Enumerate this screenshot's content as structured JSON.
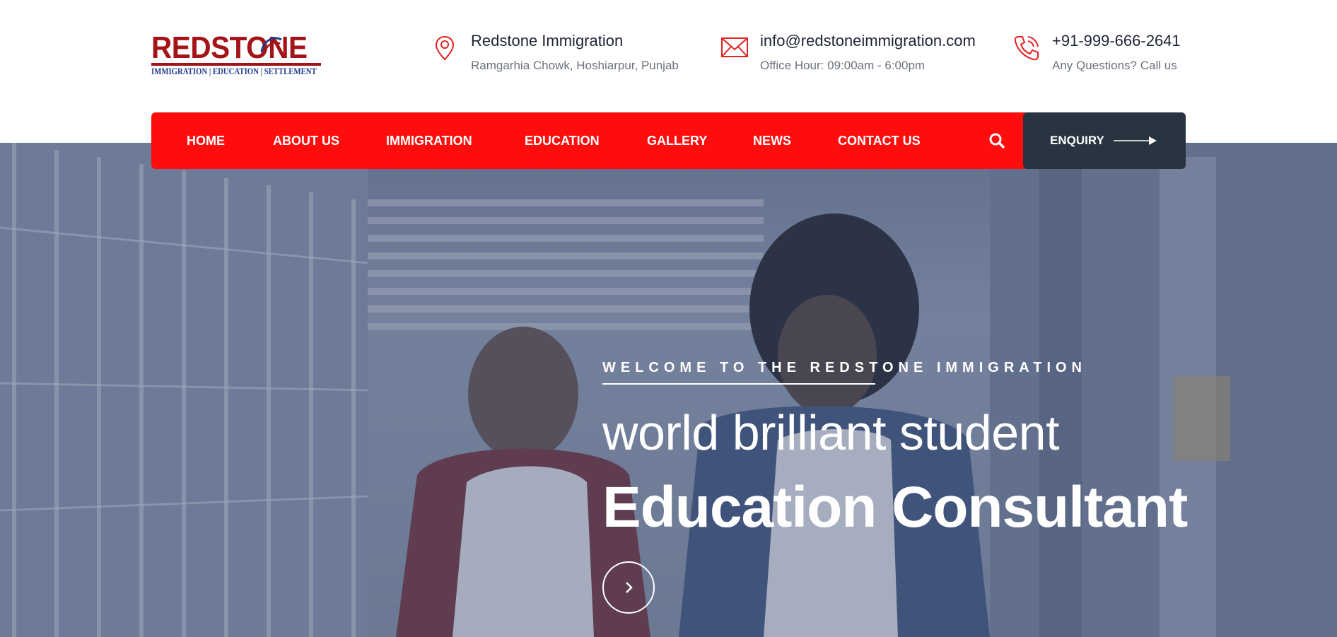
{
  "brand": {
    "logo_wordmark": "REDSTONE",
    "logo_tagline": "IMMIGRATION | EDUCATION | SETTLEMENT",
    "colors": {
      "primary_red": "#ff0d0d",
      "logo_red": "#a31317",
      "logo_blue": "#1f3c8c",
      "dark_button": "#283440"
    }
  },
  "header": {
    "address": {
      "icon": "map-pin-icon",
      "title": "Redstone Immigration",
      "subtitle": "Ramgarhia Chowk, Hoshiarpur, Punjab"
    },
    "email": {
      "icon": "envelope-icon",
      "title": "info@redstoneimmigration.com",
      "subtitle": "Office Hour: 09:00am - 6:00pm"
    },
    "phone": {
      "icon": "phone-icon",
      "title": "+91-999-666-2641",
      "subtitle": "Any Questions? Call us"
    }
  },
  "nav": {
    "items": [
      {
        "label": "HOME"
      },
      {
        "label": "ABOUT US"
      },
      {
        "label": "IMMIGRATION"
      },
      {
        "label": "EDUCATION"
      },
      {
        "label": "GALLERY"
      },
      {
        "label": "NEWS"
      },
      {
        "label": "CONTACT US"
      }
    ],
    "search_icon": "search-icon",
    "enquiry_label": "ENQUIRY",
    "enquiry_icon": "arrow-right-icon"
  },
  "hero": {
    "eyebrow": "WELCOME TO THE REDSTONE IMMIGRATION",
    "line1": "world brilliant student",
    "line2": "Education Consultant",
    "next_icon": "chevron-right-icon"
  }
}
